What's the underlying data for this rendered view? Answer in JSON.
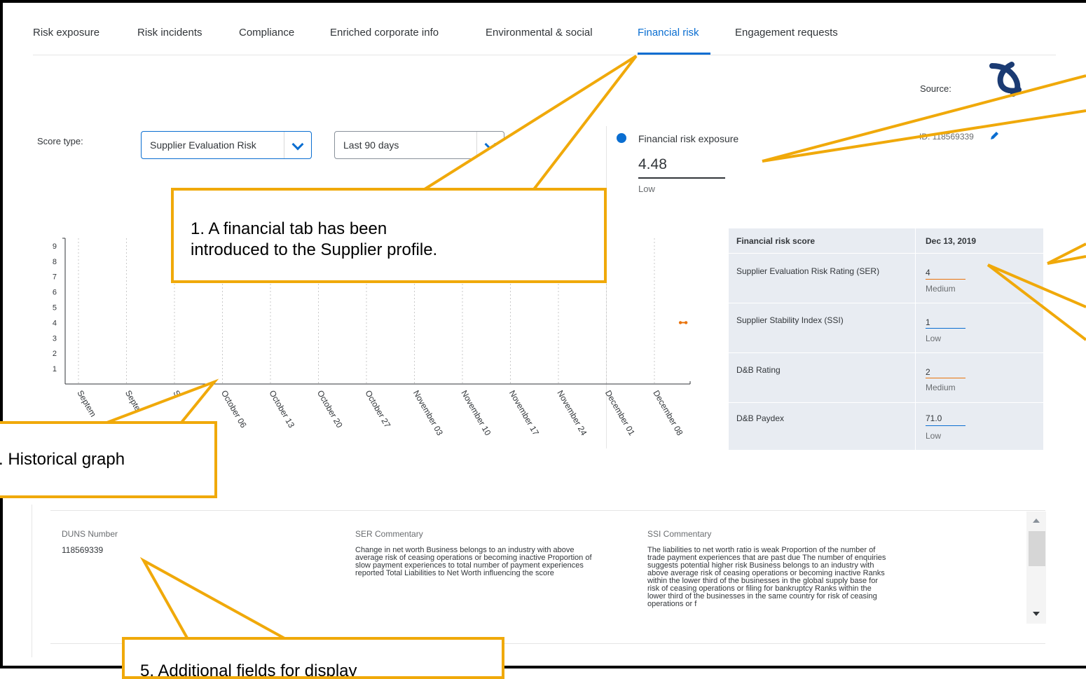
{
  "tabs": [
    {
      "label": "Risk exposure",
      "active": false
    },
    {
      "label": "Risk incidents",
      "active": false
    },
    {
      "label": "Compliance",
      "active": false
    },
    {
      "label": "Enriched corporate info",
      "active": false
    },
    {
      "label": "Environmental & social",
      "active": false
    },
    {
      "label": "Financial risk",
      "active": true
    },
    {
      "label": "Engagement requests",
      "active": false
    }
  ],
  "source_label": "Source:",
  "duns_header": "ID: 118569339",
  "filters": {
    "score_type_label": "Score type:",
    "score_type_value": "Supplier Evaluation Risk",
    "period_value": "Last 90 days"
  },
  "exposure": {
    "title": "Financial risk exposure",
    "value": "4.48",
    "level": "Low"
  },
  "score_table": {
    "header_name": "Financial risk score",
    "header_date": "Dec 13, 2019",
    "rows": [
      {
        "name": "Supplier Evaluation Risk Rating (SER)",
        "value": "4",
        "level": "Medium",
        "color": "#e9730c"
      },
      {
        "name": "Supplier Stability Index (SSI)",
        "value": "1",
        "level": "Low",
        "color": "#0a6ed1"
      },
      {
        "name": "D&B Rating",
        "value": "2",
        "level": "Medium",
        "color": "#e9730c"
      },
      {
        "name": "D&B Paydex",
        "value": "71.0",
        "level": "Low",
        "color": "#0a6ed1"
      }
    ]
  },
  "chart_data": {
    "type": "line",
    "y_ticks": [
      "1",
      "2",
      "3",
      "4",
      "5",
      "6",
      "7",
      "8",
      "9"
    ],
    "ylim": [
      0,
      9.5
    ],
    "categories": [
      "Septem",
      "Septe",
      "S",
      "October 06",
      "October 13",
      "October 20",
      "October 27",
      "November 03",
      "November 10",
      "November 17",
      "November 24",
      "December 01",
      "December 08"
    ],
    "series": [
      {
        "x_index": 12.6,
        "y": 4,
        "color": "#e9730c"
      }
    ],
    "grid": "vertical dashed"
  },
  "details": {
    "duns_label": "DUNS Number",
    "duns_value": "118569339",
    "ser_label": "SER Commentary",
    "ser_lines": [
      "Change in net worth Business belongs to an industry with above",
      "average risk of ceasing operations or becoming inactive Proportion of",
      "slow payment experiences to total number of payment experiences",
      "reported Total Liabilities to Net Worth influencing the score"
    ],
    "ssi_label": "SSI Commentary",
    "ssi_lines": [
      "The liabilities to net worth ratio is weak Proportion of the number of",
      "trade payment experiences that are past due The number of enquiries",
      "suggests potential higher risk Business belongs to an industry with",
      "above average risk of ceasing operations or becoming inactive Ranks",
      "within the lower third of the businesses in the global supply base for",
      "risk of ceasing operations or filing for bankruptcy Ranks within the",
      "lower third of the businesses in the same country for risk of ceasing",
      "operations or f"
    ]
  },
  "callouts": {
    "tab_note_line1": "1. A financial tab has been",
    "tab_note_line2": "introduced to the Supplier profile.",
    "graph_note": ". Historical graph",
    "fields_note": "5. Additional fields for display"
  },
  "colors": {
    "accent": "#0a6ed1",
    "callout": "#f0a90a",
    "medium": "#e9730c"
  }
}
